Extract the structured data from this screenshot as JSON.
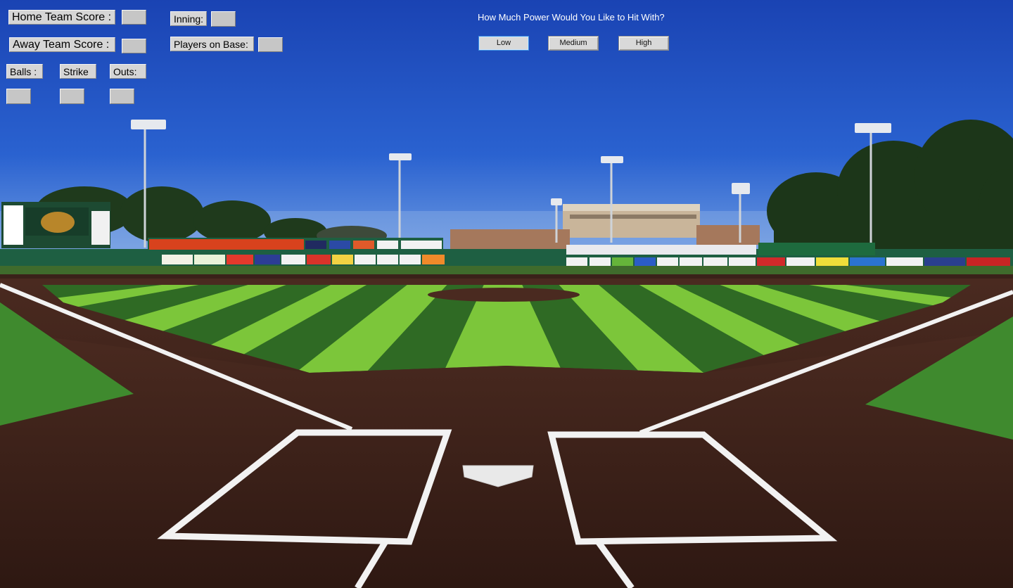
{
  "scoreboard": {
    "home_label": "Home Team Score :",
    "away_label": "Away Team Score :",
    "inning_label": "Inning:",
    "players_on_base_label": "Players on Base:",
    "balls_label": "Balls :",
    "strike_label": "Strike",
    "outs_label": "Outs:",
    "home_value": "",
    "away_value": "",
    "inning_value": "",
    "players_on_base_value": "",
    "balls_value": "",
    "strike_value": "",
    "outs_value": ""
  },
  "power": {
    "prompt": "How Much Power Would You Like to Hit With?",
    "options": [
      "Low",
      "Medium",
      "High"
    ],
    "focused": "Low"
  },
  "colors": {
    "sky_top": "#1a47b8",
    "sky_horizon": "#6d9ee8",
    "grass_light": "#7cc63a",
    "grass_dark": "#2f6a24",
    "dirt": "#3b2019",
    "chalk": "#f2f2f2",
    "wall": "#1e5f42"
  }
}
